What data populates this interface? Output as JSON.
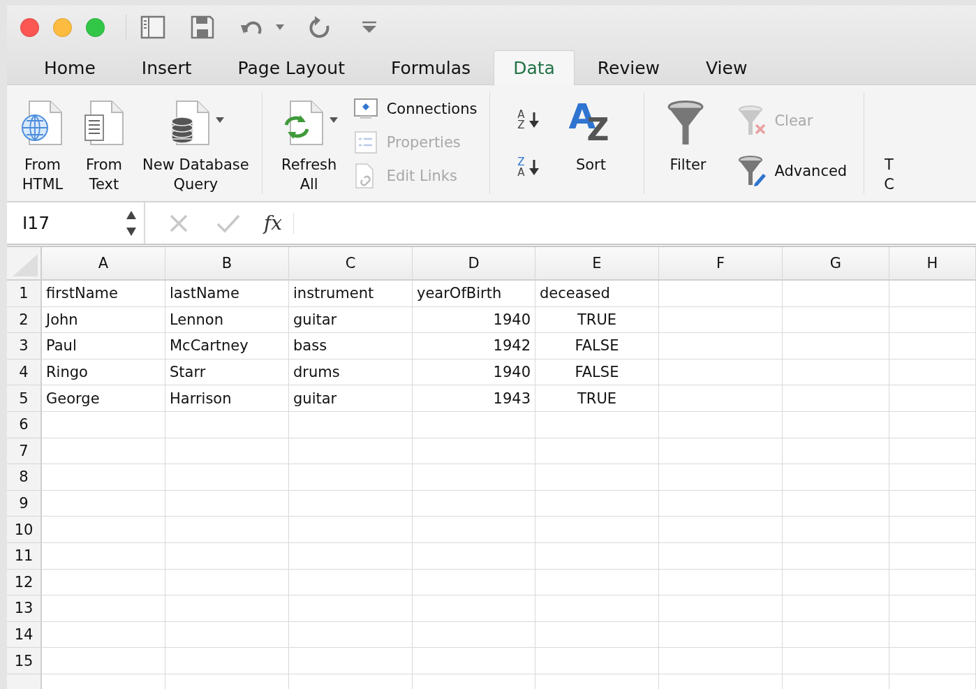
{
  "tabs": [
    {
      "label": "Home",
      "selected": false
    },
    {
      "label": "Insert",
      "selected": false
    },
    {
      "label": "Page Layout",
      "selected": false
    },
    {
      "label": "Formulas",
      "selected": false
    },
    {
      "label": "Data",
      "selected": true
    },
    {
      "label": "Review",
      "selected": false
    },
    {
      "label": "View",
      "selected": false
    }
  ],
  "ribbon": {
    "external_data": [
      {
        "lines": [
          "From",
          "HTML"
        ],
        "kind": "html",
        "dropdown": false
      },
      {
        "lines": [
          "From",
          "Text"
        ],
        "kind": "text",
        "dropdown": false
      },
      {
        "lines": [
          "New Database",
          "Query"
        ],
        "kind": "database",
        "dropdown": true
      }
    ],
    "refresh": {
      "lines": [
        "Refresh",
        "All"
      ],
      "dropdown": true
    },
    "connections": [
      {
        "label": "Connections",
        "disabled": false
      },
      {
        "label": "Properties",
        "disabled": true
      },
      {
        "label": "Edit Links",
        "disabled": true
      }
    ],
    "sort_small": [
      {
        "letters": [
          "A",
          "Z"
        ]
      },
      {
        "letters": [
          "Z",
          "A"
        ]
      }
    ],
    "sort": {
      "letters": [
        "A",
        "Z"
      ],
      "label": "Sort"
    },
    "filter": {
      "label": "Filter"
    },
    "filter_options": [
      {
        "label": "Clear",
        "disabled": true,
        "kind": "clear"
      },
      {
        "label": "Advanced",
        "disabled": false,
        "kind": "advanced"
      }
    ],
    "cut_group": {
      "lines": [
        "T",
        "C"
      ]
    }
  },
  "formula_bar": {
    "name_box": "I17",
    "function_symbol": "fx"
  },
  "sheet": {
    "columns": [
      "A",
      "B",
      "C",
      "D",
      "E",
      "F",
      "G",
      "H"
    ],
    "rows": [
      {
        "number": "1",
        "cells": [
          {
            "value": "firstName",
            "kind": "text"
          },
          {
            "value": "lastName",
            "kind": "text"
          },
          {
            "value": "instrument",
            "kind": "text"
          },
          {
            "value": "yearOfBirth",
            "kind": "text"
          },
          {
            "value": "deceased",
            "kind": "text"
          }
        ]
      },
      {
        "number": "2",
        "cells": [
          {
            "value": "John",
            "kind": "text"
          },
          {
            "value": "Lennon",
            "kind": "text"
          },
          {
            "value": "guitar",
            "kind": "text"
          },
          {
            "value": "1940",
            "kind": "number"
          },
          {
            "value": "TRUE",
            "kind": "boolean"
          }
        ]
      },
      {
        "number": "3",
        "cells": [
          {
            "value": "Paul",
            "kind": "text"
          },
          {
            "value": "McCartney",
            "kind": "text"
          },
          {
            "value": "bass",
            "kind": "text"
          },
          {
            "value": "1942",
            "kind": "number"
          },
          {
            "value": "FALSE",
            "kind": "boolean"
          }
        ]
      },
      {
        "number": "4",
        "cells": [
          {
            "value": "Ringo",
            "kind": "text"
          },
          {
            "value": "Starr",
            "kind": "text"
          },
          {
            "value": "drums",
            "kind": "text"
          },
          {
            "value": "1940",
            "kind": "number"
          },
          {
            "value": "FALSE",
            "kind": "boolean"
          }
        ]
      },
      {
        "number": "5",
        "cells": [
          {
            "value": "George",
            "kind": "text"
          },
          {
            "value": "Harrison",
            "kind": "text"
          },
          {
            "value": "guitar",
            "kind": "text"
          },
          {
            "value": "1943",
            "kind": "number"
          },
          {
            "value": "TRUE",
            "kind": "boolean"
          }
        ]
      },
      {
        "number": "6"
      },
      {
        "number": "7"
      },
      {
        "number": "8"
      },
      {
        "number": "9"
      },
      {
        "number": "10"
      },
      {
        "number": "11"
      },
      {
        "number": "12"
      },
      {
        "number": "13"
      },
      {
        "number": "14"
      },
      {
        "number": "15"
      }
    ]
  }
}
